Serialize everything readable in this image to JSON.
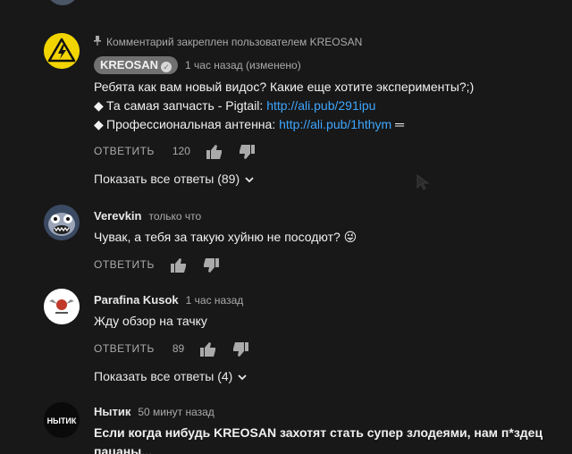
{
  "comments": [
    {
      "pinned_text": "Комментарий закреплен пользователем KREOSAN",
      "author": "KREOSAN",
      "time": "1 час назад (изменено)",
      "line1": "Ребята как вам новый видос? Какие еще хотите эксперименты?;)",
      "line2_text": "Та самая запчасть - Pigtail: ",
      "line2_link": "http://ali.pub/291ipu",
      "line3_text": "Профессиональная антенна: ",
      "line3_link": "http://ali.pub/1hthym",
      "line3_suffix": " ═",
      "reply_label": "ОТВЕТИТЬ",
      "likes": "120",
      "show_replies": "Показать все ответы (89)"
    },
    {
      "author": "Verevkin",
      "time": "только что",
      "text": "Чувак, а тебя за такую хуйню не посодют?",
      "emoji": "😜",
      "reply_label": "ОТВЕТИТЬ"
    },
    {
      "author": "Parafina Kusok",
      "time": "1 час назад",
      "text": "Жду обзор на тачку",
      "reply_label": "ОТВЕТИТЬ",
      "likes": "89",
      "show_replies": "Показать все ответы (4)"
    },
    {
      "author": "Нытик",
      "avatar_text": "НЫТИК",
      "time": "50 минут назад",
      "text": "Если когда нибудь KREOSAN захотят стать супер злодеями, нам п*здец пацаны..."
    }
  ],
  "colors": {
    "background": "#181818",
    "link": "#3ea6ff",
    "muted": "#aaaaaa",
    "badge": "#717171",
    "kreosan_yellow": "#f2d400"
  }
}
